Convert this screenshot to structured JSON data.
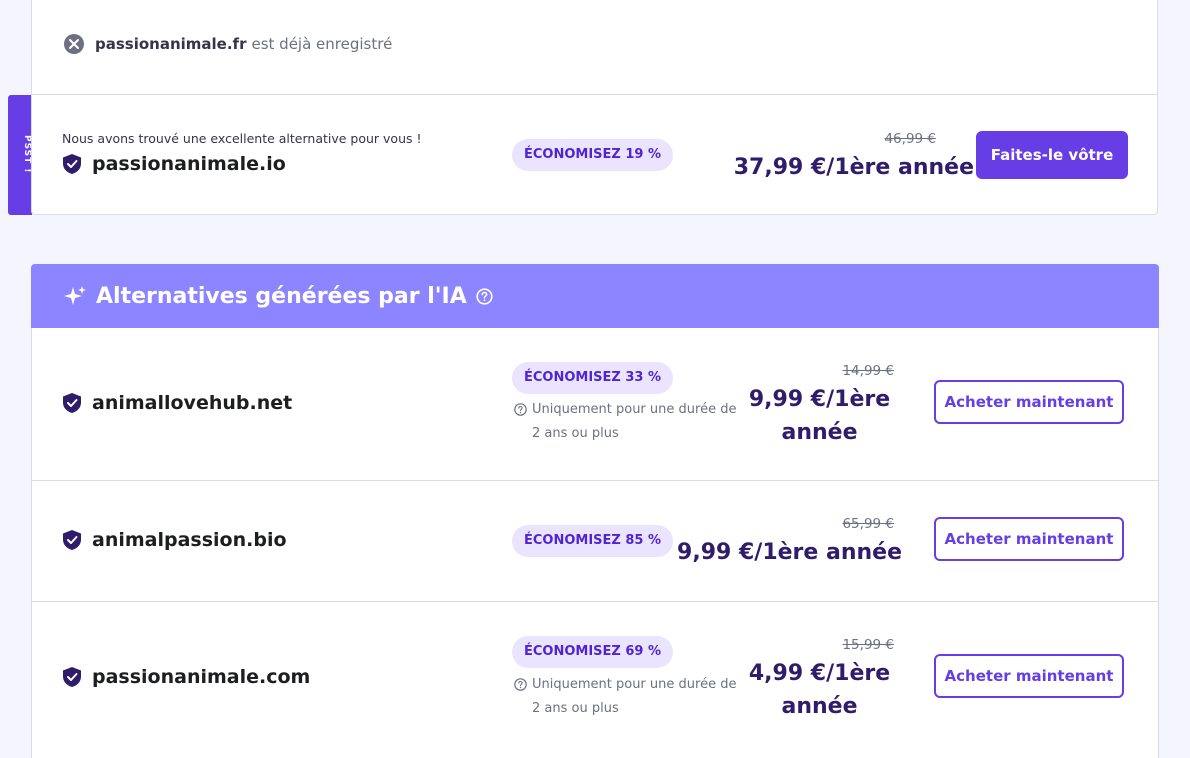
{
  "psst_tab": {
    "label": "PSST !"
  },
  "taken_notice": {
    "domain": "passionanimale.fr",
    "message": "est déjà enregistré"
  },
  "recommended": {
    "note": "Nous avons trouvé une excellente alternative pour vous !",
    "domain": "passionanimale.io",
    "badge": "ÉCONOMISEZ 19 %",
    "old_price": "46,99 €",
    "price": "37,99 €/1ère année",
    "button_label": "Faites-le vôtre"
  },
  "ai_section": {
    "title": "Alternatives générées par l'IA",
    "items": [
      {
        "domain": "animallovehub.net",
        "badge": "ÉCONOMISEZ 33 %",
        "note_line1": "Uniquement pour une durée de",
        "note_line2": "2 ans ou plus",
        "old_price": "14,99 €",
        "price_line1": "9,99 €/1ère",
        "price_line2": "année",
        "button_label": "Acheter maintenant"
      },
      {
        "domain": "animalpassion.bio",
        "badge": "ÉCONOMISEZ 85 %",
        "old_price": "65,99 €",
        "price": "9,99 €/1ère année",
        "button_label": "Acheter maintenant"
      },
      {
        "domain": "passionanimale.com",
        "badge": "ÉCONOMISEZ 69 %",
        "note_line1": "Uniquement pour une durée de",
        "note_line2": "2 ans ou plus",
        "old_price": "15,99 €",
        "price_line1": "4,99 €/1ère",
        "price_line2": "année",
        "button_label": "Acheter maintenant"
      }
    ]
  },
  "colors": {
    "primary": "#673de6",
    "ai_header": "#8c85ff",
    "badge_bg": "#ebe4ff",
    "text_dark": "#2f1c6a"
  }
}
